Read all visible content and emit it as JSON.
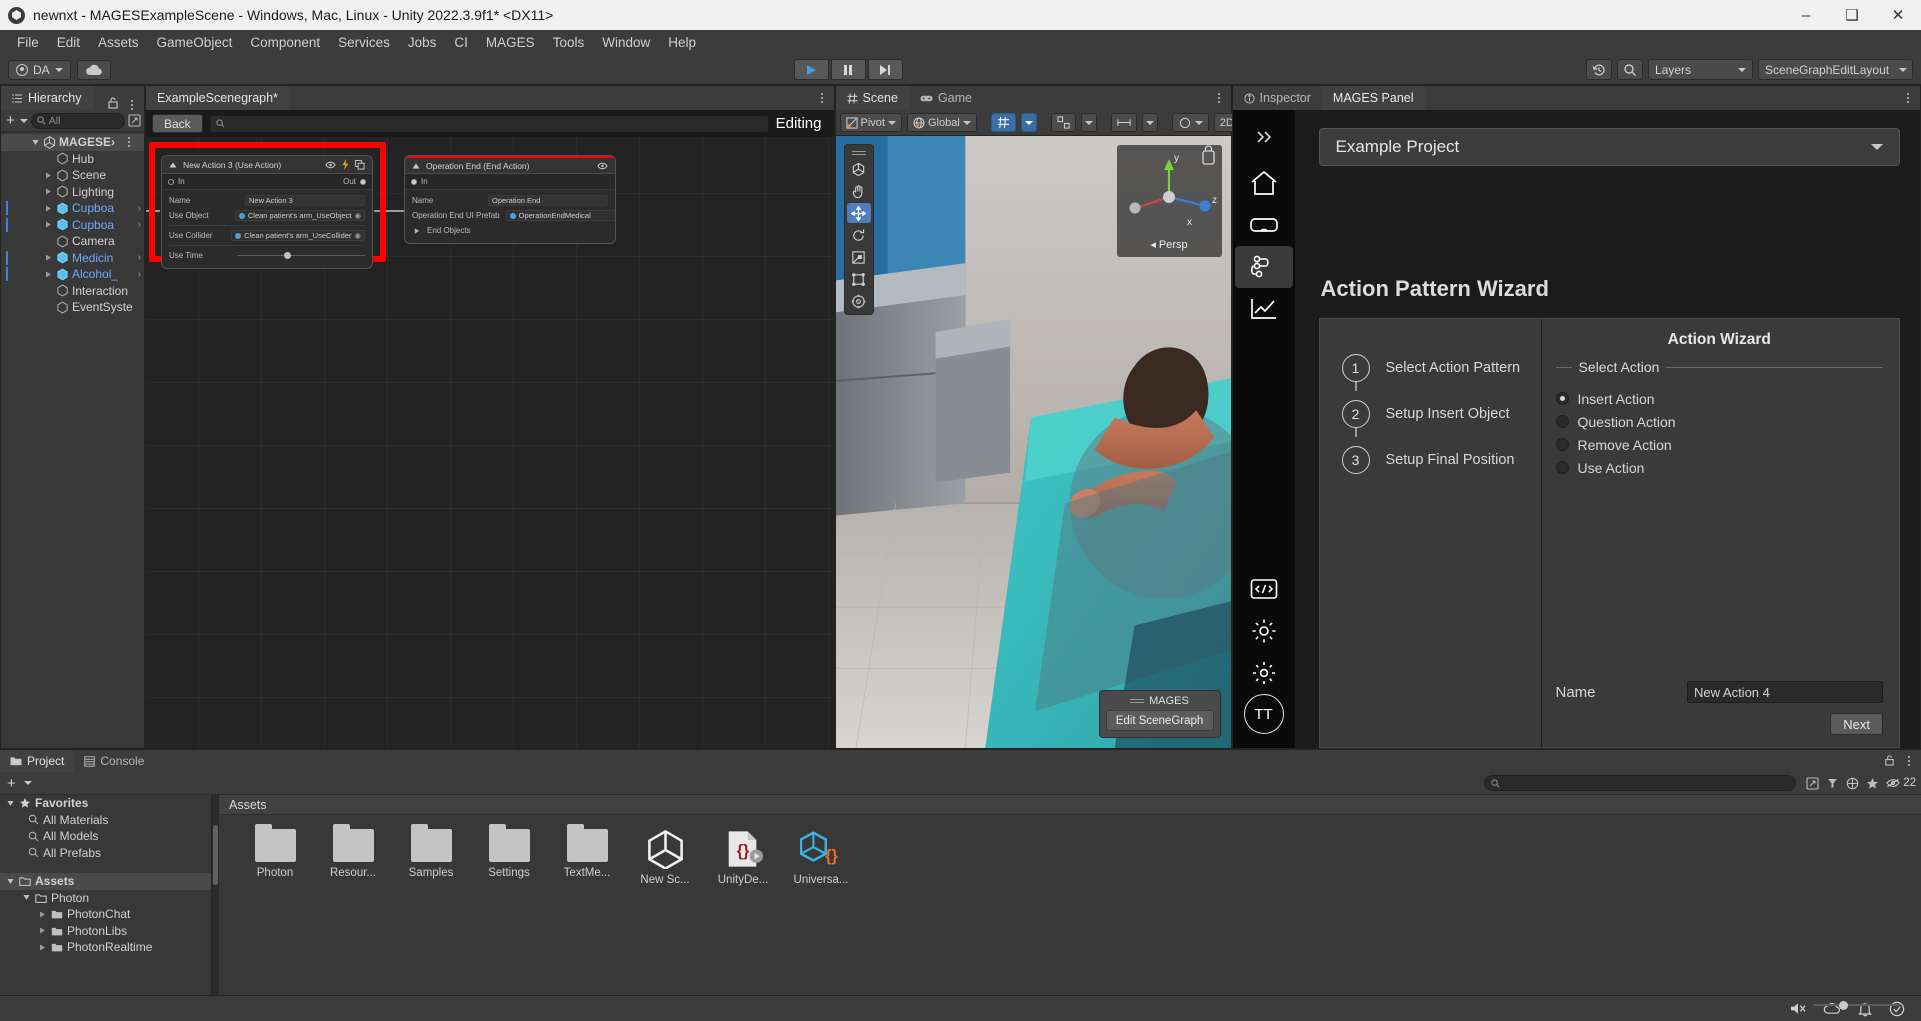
{
  "window": {
    "title": "newnxt - MAGESExampleScene - Windows, Mac, Linux - Unity 2022.3.9f1* <DX11>",
    "minimize": "–",
    "maximize": "❑",
    "close": "✕"
  },
  "menu": [
    "File",
    "Edit",
    "Assets",
    "GameObject",
    "Component",
    "Services",
    "Jobs",
    "CI",
    "MAGES",
    "Tools",
    "Window",
    "Help"
  ],
  "toolbar": {
    "account": "DA",
    "layers_label": "Layers",
    "layout_label": "SceneGraphEditLayout"
  },
  "hierarchy": {
    "tab": "Hierarchy",
    "search_placeholder": "All",
    "items": [
      {
        "label": "MAGESE›",
        "kind": "root"
      },
      {
        "label": "Hub",
        "kind": "go"
      },
      {
        "label": "Scene",
        "kind": "go"
      },
      {
        "label": "Lighting",
        "kind": "go"
      },
      {
        "label": "Cupboa",
        "kind": "prefab"
      },
      {
        "label": "Cupboa",
        "kind": "prefab"
      },
      {
        "label": "Camera",
        "kind": "go"
      },
      {
        "label": "Medicin",
        "kind": "prefab"
      },
      {
        "label": "Alcohol_",
        "kind": "prefab"
      },
      {
        "label": "Interaction",
        "kind": "go"
      },
      {
        "label": "EventSyste",
        "kind": "go"
      }
    ]
  },
  "scenegraph": {
    "tab": "ExampleScenegraph*",
    "back_label": "Back",
    "search_placeholder": "",
    "editing_label": "Editing",
    "nodes": [
      {
        "title": "New Action 3 (Use Action)",
        "in_label": "In",
        "out_label": "Out",
        "fields": [
          {
            "label": "Name",
            "value": "New Action 3",
            "type": "text"
          },
          {
            "label": "Use Object",
            "value": "Clean patient's arm_UseObject",
            "type": "object"
          },
          {
            "label": "Use Collider",
            "value": "Clean patient's arm_UseCollider",
            "type": "object"
          },
          {
            "label": "Use Time",
            "value": "",
            "type": "slider"
          }
        ]
      },
      {
        "title": "Operation End (End Action)",
        "in_label": "In",
        "out_label": "",
        "fields": [
          {
            "label": "Name",
            "value": "Operation End",
            "type": "text"
          },
          {
            "label": "Operation End UI Prefab",
            "value": "OperationEndMedical",
            "type": "object"
          },
          {
            "label": "End Objects",
            "value": "",
            "type": "foldout"
          }
        ]
      }
    ]
  },
  "scene": {
    "tabs": [
      {
        "label": "Scene",
        "active": true
      },
      {
        "label": "Game",
        "active": false
      }
    ],
    "pivot_label": "Pivot",
    "global_label": "Global",
    "twod_label": "2D",
    "gizmo": {
      "x": "x",
      "y": "y",
      "z": "z",
      "persp": "Persp"
    },
    "overlay": {
      "title": "MAGES",
      "button": "Edit SceneGraph"
    }
  },
  "inspector": {
    "tabs": [
      {
        "label": "Inspector",
        "active": false
      },
      {
        "label": "MAGES Panel",
        "active": true
      }
    ]
  },
  "mages": {
    "project_selector": "Example Project",
    "panel_title": "Action Pattern Wizard",
    "rail_icons": [
      "home-icon",
      "vr-headset-icon",
      "scenegraph-icon",
      "analytics-icon",
      "code-icon",
      "settings-gear-icon",
      "preferences-gear-icon"
    ],
    "rail_avatar": "TT",
    "steps": [
      {
        "num": "1",
        "label": "Select Action Pattern"
      },
      {
        "num": "2",
        "label": "Setup Insert Object"
      },
      {
        "num": "3",
        "label": "Setup Final Position"
      }
    ],
    "wizard": {
      "header": "Action Wizard",
      "section_label": "Select Action",
      "options": [
        {
          "label": "Insert Action",
          "selected": true
        },
        {
          "label": "Question Action",
          "selected": false
        },
        {
          "label": "Remove Action",
          "selected": false
        },
        {
          "label": "Use Action",
          "selected": false
        }
      ],
      "name_label": "Name",
      "name_value": "New Action 4",
      "next_label": "Next"
    }
  },
  "project": {
    "tabs": [
      {
        "label": "Project",
        "active": true
      },
      {
        "label": "Console",
        "active": false
      }
    ],
    "search_placeholder": "",
    "badge_count": "22",
    "tree": [
      {
        "label": "Favorites",
        "depth": 0,
        "icon": "star-icon",
        "expanded": true
      },
      {
        "label": "All Materials",
        "depth": 1,
        "icon": "search-icon"
      },
      {
        "label": "All Models",
        "depth": 1,
        "icon": "search-icon"
      },
      {
        "label": "All Prefabs",
        "depth": 1,
        "icon": "search-icon"
      },
      {
        "label": "Assets",
        "depth": 0,
        "icon": "folder-icon",
        "expanded": true,
        "selected": true
      },
      {
        "label": "Photon",
        "depth": 1,
        "icon": "folder-icon",
        "expanded": true
      },
      {
        "label": "PhotonChat",
        "depth": 2,
        "icon": "folder-icon"
      },
      {
        "label": "PhotonLibs",
        "depth": 2,
        "icon": "folder-icon"
      },
      {
        "label": "PhotonRealtime",
        "depth": 2,
        "icon": "folder-icon"
      }
    ],
    "breadcrumb": "Assets",
    "assets": [
      {
        "name": "Photon",
        "icon": "folder-icon"
      },
      {
        "name": "Resour...",
        "icon": "folder-icon"
      },
      {
        "name": "Samples",
        "icon": "folder-icon"
      },
      {
        "name": "Settings",
        "icon": "folder-icon"
      },
      {
        "name": "TextMe...",
        "icon": "folder-icon"
      },
      {
        "name": "New Sc...",
        "icon": "unity-scene-icon"
      },
      {
        "name": "UnityDe...",
        "icon": "json-file-icon"
      },
      {
        "name": "Universa...",
        "icon": "unity-package-icon"
      }
    ]
  },
  "colors": {
    "accent_blue": "#3a6ea5",
    "prefab_blue": "#72a9f5",
    "highlight_red": "#ff0000"
  }
}
